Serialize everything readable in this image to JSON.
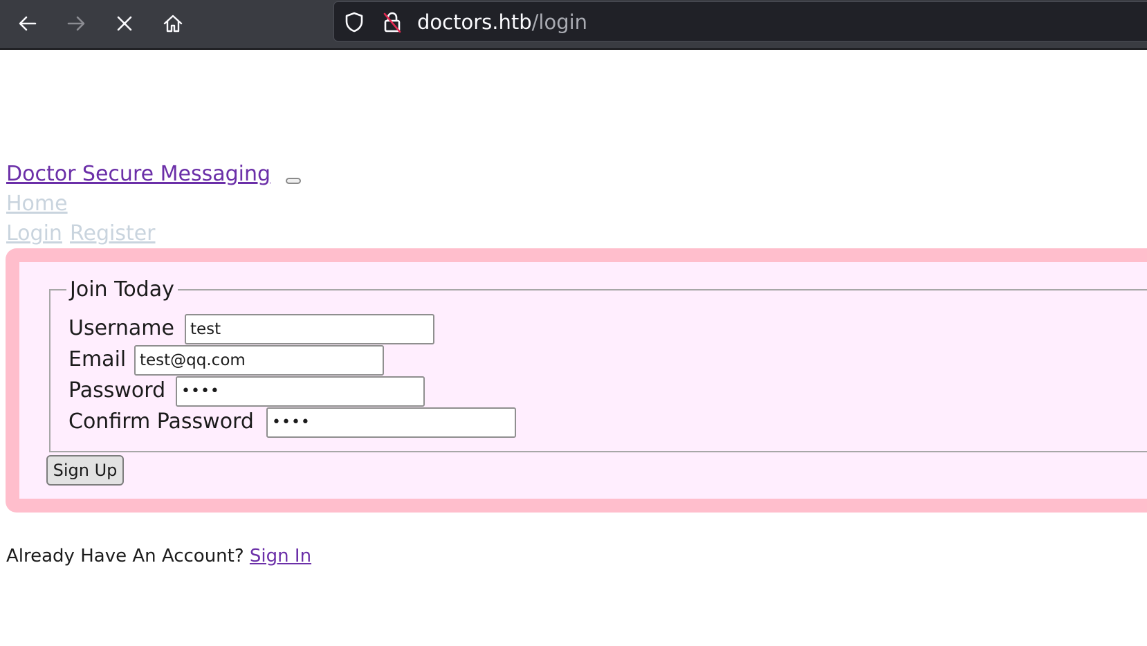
{
  "browser": {
    "url_host": "doctors.htb",
    "url_path": "/login",
    "icons": [
      "back-arrow-icon",
      "forward-arrow-icon",
      "stop-icon",
      "home-icon",
      "shield-icon",
      "insecure-lock-icon"
    ]
  },
  "navbar": {
    "brand": "Doctor Secure Messaging",
    "home": "Home",
    "login": "Login",
    "register": "Register"
  },
  "form": {
    "legend": "Join Today",
    "username_label": "Username",
    "username_value": "test",
    "email_label": "Email",
    "email_value": "test@qq.com",
    "password_label": "Password",
    "password_value": "••••",
    "confirm_label": "Confirm Password",
    "confirm_value": "••••",
    "submit": "Sign Up"
  },
  "footer": {
    "prompt": "Already Have An Account?",
    "signin": "Sign In"
  },
  "colors": {
    "link": "#6b2fa8",
    "nav_link": "#c9d4de",
    "panel_border": "#ffbecc",
    "panel_bg": "#ffeefe",
    "toolbar": "#3a3c42"
  }
}
